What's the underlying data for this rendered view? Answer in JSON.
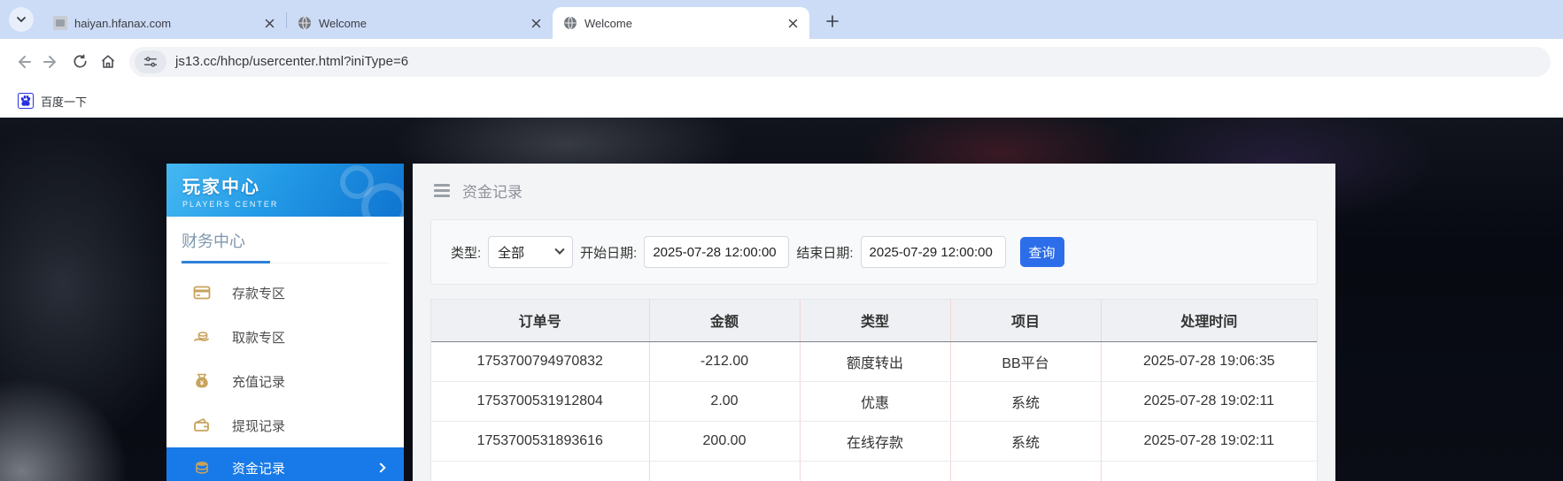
{
  "browser": {
    "tabs": [
      {
        "title": "haiyan.hfanax.com"
      },
      {
        "title": "Welcome"
      },
      {
        "title": "Welcome"
      }
    ],
    "url": "js13.cc/hhcp/usercenter.html?iniType=6",
    "bookmark": {
      "label": "百度一下"
    }
  },
  "sidebar": {
    "banner_title": "玩家中心",
    "banner_subtitle": "PLAYERS CENTER",
    "section": "财务中心",
    "items": [
      {
        "label": "存款专区"
      },
      {
        "label": "取款专区"
      },
      {
        "label": "充值记录"
      },
      {
        "label": "提现记录"
      },
      {
        "label": "资金记录"
      }
    ]
  },
  "main": {
    "title": "资金记录",
    "filters": {
      "type_label": "类型:",
      "type_value": "全部",
      "start_label": "开始日期:",
      "start_value": "2025-07-28 12:00:00",
      "end_label": "结束日期:",
      "end_value": "2025-07-29 12:00:00",
      "search_label": "查询"
    },
    "table": {
      "columns": [
        "订单号",
        "金额",
        "类型",
        "项目",
        "处理时间"
      ],
      "rows": [
        [
          "1753700794970832",
          "-212.00",
          "额度转出",
          "BB平台",
          "2025-07-28 19:06:35"
        ],
        [
          "1753700531912804",
          "2.00",
          "优惠",
          "系统",
          "2025-07-28 19:02:11"
        ],
        [
          "1753700531893616",
          "200.00",
          "在线存款",
          "系统",
          "2025-07-28 19:02:11"
        ]
      ]
    }
  },
  "colors": {
    "tabstrip_bg": "#ccdbf6",
    "banner_blue_top": "#45b8f2",
    "banner_blue_bottom": "#0f74d0",
    "active_item_blue": "#187ae8",
    "search_button_blue": "#2c6de9",
    "gold_icon": "#c8a35c",
    "table_divider_pink": "#f3d7d7"
  }
}
